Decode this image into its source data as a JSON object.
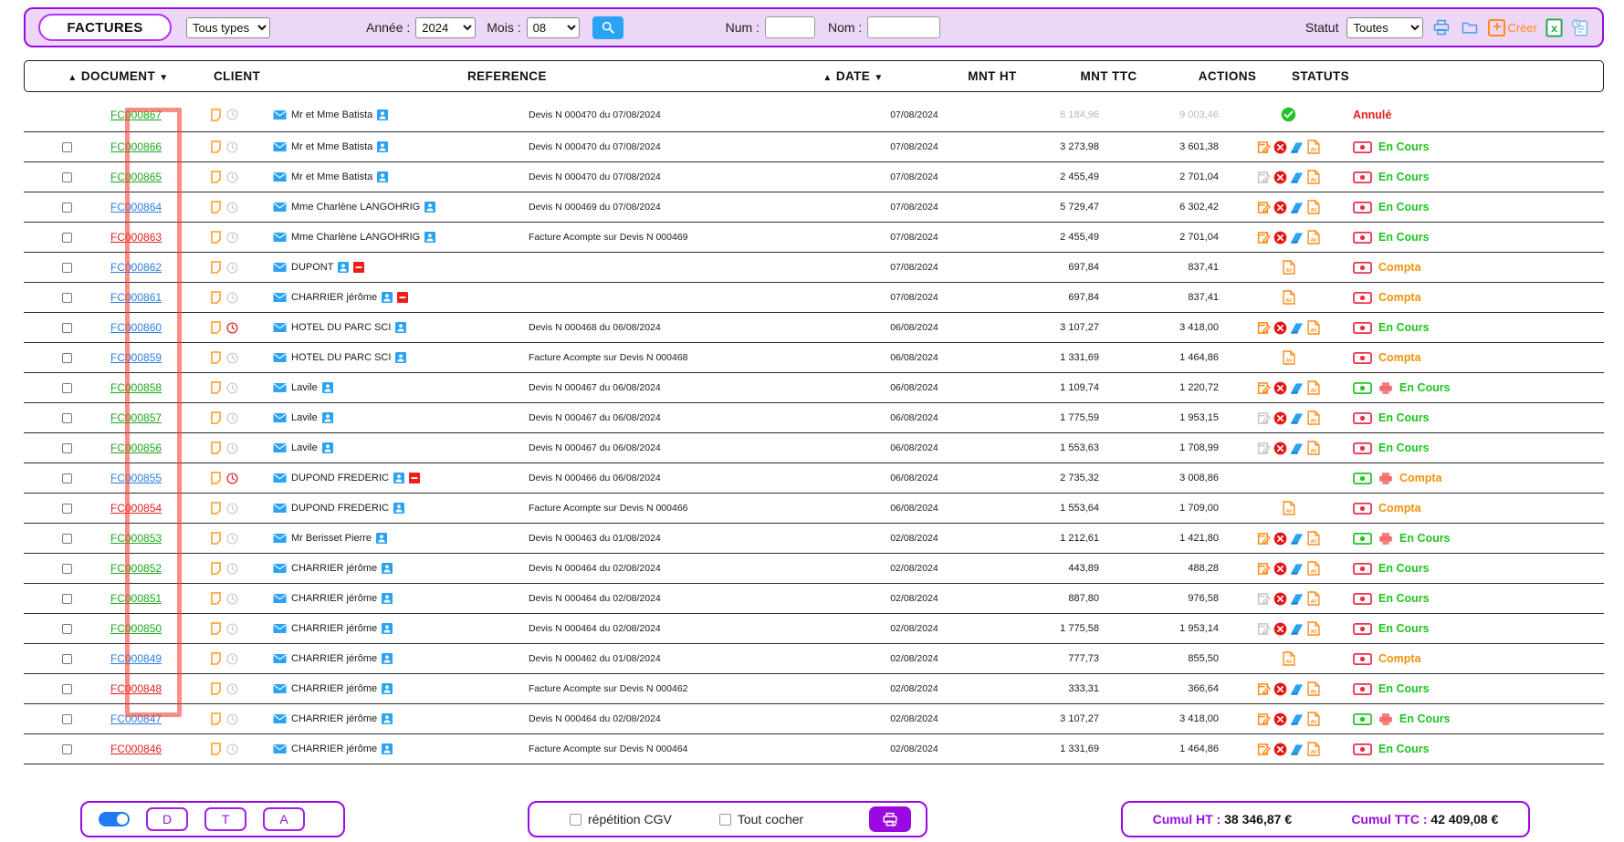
{
  "toolbar": {
    "title": "FACTURES",
    "type_filter": {
      "selected": "Tous types",
      "options": [
        "Tous types"
      ]
    },
    "annee_label": "Année :",
    "annee": {
      "selected": "2024",
      "options": [
        "2024"
      ]
    },
    "mois_label": "Mois :",
    "mois": {
      "selected": "08",
      "options": [
        "08"
      ]
    },
    "search_icon": "search-icon",
    "num_label": "Num :",
    "num_value": "",
    "num_placeholder": "",
    "nom_label": "Nom :",
    "nom_value": "",
    "nom_placeholder": "",
    "statut_label": "Statut",
    "statut": {
      "selected": "Toutes",
      "options": [
        "Toutes"
      ]
    },
    "print_icon": "printer-icon",
    "folder_icon": "folder-icon",
    "creer_label": "Créer",
    "creer_icon": "plus-icon",
    "excel_icon": "excel-export-icon",
    "history_icon": "clipboard-history-icon"
  },
  "table": {
    "headers": {
      "document": "DOCUMENT",
      "client": "CLIENT",
      "reference": "REFERENCE",
      "date": "DATE",
      "mnt_ht": "MNT HT",
      "mnt_ttc": "MNT TTC",
      "actions": "ACTIONS",
      "statuts": "STATUTS"
    },
    "sort_asc_glyph": "▲",
    "sort_desc_glyph": "▼",
    "rows": [
      {
        "doc": "FC000867",
        "doc_color": "green",
        "checkbox": false,
        "clock": "grey",
        "client": "Mr et Mme Batista",
        "minus": false,
        "ref": "Devis N 000470 du 07/08/2024",
        "date": "07/08/2024",
        "ht": "8 184,96",
        "ttc": "9 003,46",
        "muted": true,
        "actions": [
          "check"
        ],
        "money": "none",
        "printer": false,
        "status": "Annulé",
        "status_color": "red"
      },
      {
        "doc": "FC000866",
        "doc_color": "green",
        "checkbox": true,
        "clock": "grey",
        "client": "Mr et Mme Batista",
        "minus": false,
        "ref": "Devis N 000470 du 07/08/2024",
        "date": "07/08/2024",
        "ht": "3 273,98",
        "ttc": "3 601,38",
        "muted": false,
        "actions": [
          "edit",
          "del",
          "book",
          "av"
        ],
        "money": "red",
        "printer": false,
        "status": "En Cours",
        "status_color": "green"
      },
      {
        "doc": "FC000865",
        "doc_color": "green",
        "checkbox": true,
        "clock": "grey",
        "client": "Mr et Mme Batista",
        "minus": false,
        "ref": "Devis N 000470 du 07/08/2024",
        "date": "07/08/2024",
        "ht": "2 455,49",
        "ttc": "2 701,04",
        "muted": false,
        "actions": [
          "edit-grey",
          "del",
          "book",
          "av"
        ],
        "money": "red",
        "printer": false,
        "status": "En Cours",
        "status_color": "green"
      },
      {
        "doc": "FC000864",
        "doc_color": "blue",
        "checkbox": true,
        "clock": "grey",
        "client": "Mme Charlène LANGOHRIG",
        "minus": false,
        "ref": "Devis N 000469 du 07/08/2024",
        "date": "07/08/2024",
        "ht": "5 729,47",
        "ttc": "6 302,42",
        "muted": false,
        "actions": [
          "edit",
          "del",
          "book",
          "av"
        ],
        "money": "red",
        "printer": false,
        "status": "En Cours",
        "status_color": "green"
      },
      {
        "doc": "FC000863",
        "doc_color": "red",
        "checkbox": true,
        "clock": "grey",
        "client": "Mme Charlène LANGOHRIG",
        "minus": false,
        "ref": "Facture Acompte sur Devis N 000469",
        "date": "07/08/2024",
        "ht": "2 455,49",
        "ttc": "2 701,04",
        "muted": false,
        "actions": [
          "edit",
          "del",
          "book",
          "av"
        ],
        "money": "red",
        "printer": false,
        "status": "En Cours",
        "status_color": "green"
      },
      {
        "doc": "FC000862",
        "doc_color": "blue",
        "checkbox": true,
        "clock": "grey",
        "client": "DUPONT",
        "minus": true,
        "ref": "",
        "date": "07/08/2024",
        "ht": "697,84",
        "ttc": "837,41",
        "muted": false,
        "actions": [
          "av"
        ],
        "money": "red",
        "printer": false,
        "status": "Compta",
        "status_color": "orange"
      },
      {
        "doc": "FC000861",
        "doc_color": "blue",
        "checkbox": true,
        "clock": "grey",
        "client": "CHARRIER jérôme",
        "minus": true,
        "ref": "",
        "date": "07/08/2024",
        "ht": "697,84",
        "ttc": "837,41",
        "muted": false,
        "actions": [
          "av"
        ],
        "money": "red",
        "printer": false,
        "status": "Compta",
        "status_color": "orange"
      },
      {
        "doc": "FC000860",
        "doc_color": "blue",
        "checkbox": true,
        "clock": "red",
        "client": "HOTEL DU PARC SCI",
        "minus": false,
        "ref": "Devis N 000468 du 06/08/2024",
        "date": "06/08/2024",
        "ht": "3 107,27",
        "ttc": "3 418,00",
        "muted": false,
        "actions": [
          "edit",
          "del",
          "book",
          "av"
        ],
        "money": "red",
        "printer": false,
        "status": "En Cours",
        "status_color": "green"
      },
      {
        "doc": "FC000859",
        "doc_color": "blue",
        "checkbox": true,
        "clock": "grey",
        "client": "HOTEL DU PARC SCI",
        "minus": false,
        "ref": "Facture Acompte sur Devis N 000468",
        "date": "06/08/2024",
        "ht": "1 331,69",
        "ttc": "1 464,86",
        "muted": false,
        "actions": [
          "av"
        ],
        "money": "red",
        "printer": false,
        "status": "Compta",
        "status_color": "orange"
      },
      {
        "doc": "FC000858",
        "doc_color": "green",
        "checkbox": true,
        "clock": "grey",
        "client": "Lavile",
        "minus": false,
        "ref": "Devis N 000467 du 06/08/2024",
        "date": "06/08/2024",
        "ht": "1 109,74",
        "ttc": "1 220,72",
        "muted": false,
        "actions": [
          "edit",
          "del",
          "book",
          "av"
        ],
        "money": "green",
        "printer": true,
        "status": "En Cours",
        "status_color": "green"
      },
      {
        "doc": "FC000857",
        "doc_color": "green",
        "checkbox": true,
        "clock": "grey",
        "client": "Lavile",
        "minus": false,
        "ref": "Devis N 000467 du 06/08/2024",
        "date": "06/08/2024",
        "ht": "1 775,59",
        "ttc": "1 953,15",
        "muted": false,
        "actions": [
          "edit-grey",
          "del",
          "book",
          "av"
        ],
        "money": "red",
        "printer": false,
        "status": "En Cours",
        "status_color": "green"
      },
      {
        "doc": "FC000856",
        "doc_color": "green",
        "checkbox": true,
        "clock": "grey",
        "client": "Lavile",
        "minus": false,
        "ref": "Devis N 000467 du 06/08/2024",
        "date": "06/08/2024",
        "ht": "1 553,63",
        "ttc": "1 708,99",
        "muted": false,
        "actions": [
          "edit-grey",
          "del",
          "book",
          "av"
        ],
        "money": "red",
        "printer": false,
        "status": "En Cours",
        "status_color": "green"
      },
      {
        "doc": "FC000855",
        "doc_color": "blue",
        "checkbox": true,
        "clock": "red",
        "client": "DUPOND FREDERIC",
        "minus": true,
        "ref": "Devis N 000466 du 06/08/2024",
        "date": "06/08/2024",
        "ht": "2 735,32",
        "ttc": "3 008,86",
        "muted": false,
        "actions": [],
        "money": "green",
        "printer": true,
        "status": "Compta",
        "status_color": "orange"
      },
      {
        "doc": "FC000854",
        "doc_color": "red",
        "checkbox": true,
        "clock": "grey",
        "client": "DUPOND FREDERIC",
        "minus": false,
        "ref": "Facture Acompte sur Devis N 000466",
        "date": "06/08/2024",
        "ht": "1 553,64",
        "ttc": "1 709,00",
        "muted": false,
        "actions": [
          "av"
        ],
        "money": "red",
        "printer": false,
        "status": "Compta",
        "status_color": "orange"
      },
      {
        "doc": "FC000853",
        "doc_color": "green",
        "checkbox": true,
        "clock": "grey",
        "client": "Mr Berisset Pierre",
        "minus": false,
        "ref": "Devis N 000463 du 01/08/2024",
        "date": "02/08/2024",
        "ht": "1 212,61",
        "ttc": "1 421,80",
        "muted": false,
        "actions": [
          "edit",
          "del",
          "book",
          "av"
        ],
        "money": "green",
        "printer": true,
        "status": "En Cours",
        "status_color": "green"
      },
      {
        "doc": "FC000852",
        "doc_color": "green",
        "checkbox": true,
        "clock": "grey",
        "client": "CHARRIER jérôme",
        "minus": false,
        "ref": "Devis N 000464 du 02/08/2024",
        "date": "02/08/2024",
        "ht": "443,89",
        "ttc": "488,28",
        "muted": false,
        "actions": [
          "edit",
          "del",
          "book",
          "av"
        ],
        "money": "red",
        "printer": false,
        "status": "En Cours",
        "status_color": "green"
      },
      {
        "doc": "FC000851",
        "doc_color": "green",
        "checkbox": true,
        "clock": "grey",
        "client": "CHARRIER jérôme",
        "minus": false,
        "ref": "Devis N 000464 du 02/08/2024",
        "date": "02/08/2024",
        "ht": "887,80",
        "ttc": "976,58",
        "muted": false,
        "actions": [
          "edit-grey",
          "del",
          "book",
          "av"
        ],
        "money": "red",
        "printer": false,
        "status": "En Cours",
        "status_color": "green"
      },
      {
        "doc": "FC000850",
        "doc_color": "green",
        "checkbox": true,
        "clock": "grey",
        "client": "CHARRIER jérôme",
        "minus": false,
        "ref": "Devis N 000464 du 02/08/2024",
        "date": "02/08/2024",
        "ht": "1 775,58",
        "ttc": "1 953,14",
        "muted": false,
        "actions": [
          "edit-grey",
          "del",
          "book",
          "av"
        ],
        "money": "red",
        "printer": false,
        "status": "En Cours",
        "status_color": "green"
      },
      {
        "doc": "FC000849",
        "doc_color": "blue",
        "checkbox": true,
        "clock": "grey",
        "client": "CHARRIER jérôme",
        "minus": false,
        "ref": "Devis N 000462 du 01/08/2024",
        "date": "02/08/2024",
        "ht": "777,73",
        "ttc": "855,50",
        "muted": false,
        "actions": [
          "av"
        ],
        "money": "red",
        "printer": false,
        "status": "Compta",
        "status_color": "orange"
      },
      {
        "doc": "FC000848",
        "doc_color": "red",
        "checkbox": true,
        "clock": "grey",
        "client": "CHARRIER jérôme",
        "minus": false,
        "ref": "Facture Acompte sur Devis N 000462",
        "date": "02/08/2024",
        "ht": "333,31",
        "ttc": "366,64",
        "muted": false,
        "actions": [
          "edit",
          "del",
          "book",
          "av"
        ],
        "money": "red",
        "printer": false,
        "status": "En Cours",
        "status_color": "green"
      },
      {
        "doc": "FC000847",
        "doc_color": "blue",
        "checkbox": true,
        "clock": "grey",
        "client": "CHARRIER jérôme",
        "minus": false,
        "ref": "Devis N 000464 du 02/08/2024",
        "date": "02/08/2024",
        "ht": "3 107,27",
        "ttc": "3 418,00",
        "muted": false,
        "actions": [
          "edit",
          "del",
          "book",
          "av"
        ],
        "money": "green",
        "printer": true,
        "status": "En Cours",
        "status_color": "green"
      },
      {
        "doc": "FC000846",
        "doc_color": "red",
        "checkbox": true,
        "clock": "grey",
        "client": "CHARRIER jérôme",
        "minus": false,
        "ref": "Facture Acompte sur Devis N 000464",
        "date": "02/08/2024",
        "ht": "1 331,69",
        "ttc": "1 464,86",
        "muted": false,
        "actions": [
          "edit",
          "del",
          "book",
          "av"
        ],
        "money": "red",
        "printer": false,
        "status": "En Cours",
        "status_color": "green"
      }
    ]
  },
  "footer": {
    "toggle_on": true,
    "btn_d": "D",
    "btn_t": "T",
    "btn_a": "A",
    "repetition_label": "répétition CGV",
    "repetition_checked": false,
    "tout_cocher_label": "Tout cocher",
    "tout_cocher_checked": false,
    "print_icon": "printer-check-icon",
    "cumul_ht_key": "Cumul HT :",
    "cumul_ht_value": "38 346,87 €",
    "cumul_ttc_key": "Cumul TTC :",
    "cumul_ttc_value": "42 409,08 €"
  },
  "colors": {
    "accent_purple": "#9a0ae0",
    "toolbar_bg": "#edd7f7",
    "status_green": "#1fc41f",
    "status_orange": "#f0920a",
    "status_red": "#e81b1b",
    "link_green": "#1ba81b",
    "link_blue": "#2a7fe0",
    "link_red": "#e02020",
    "icon_orange": "#ff8c1a",
    "highlight_red": "#f44336"
  }
}
